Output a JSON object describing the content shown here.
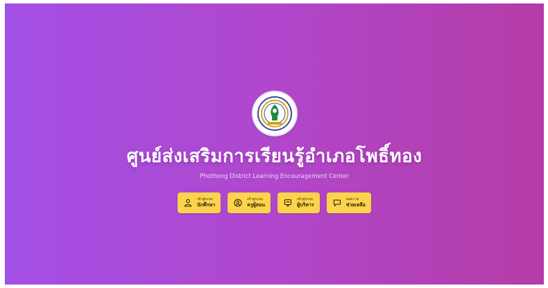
{
  "header": {
    "title": "ศูนย์ส่งเสริมการเรียนรู้อำเภอโพธิ์ทอง",
    "subtitle": "Phothong District Learning Encouragement Center"
  },
  "logo": {
    "icon": "organization-seal-icon"
  },
  "buttons": [
    {
      "small": "เข้าสู่ระบบ",
      "label": "นักศึกษา",
      "icon": "person-icon"
    },
    {
      "small": "เข้าสู่ระบบ",
      "label": "ครูผู้สอน",
      "icon": "teacher-icon"
    },
    {
      "small": "เข้าสู่ระบบ",
      "label": "ผู้บริหาร",
      "icon": "admin-icon"
    },
    {
      "small": "ขอความ",
      "label": "ช่วยเหลือ",
      "icon": "help-chat-icon"
    }
  ],
  "colors": {
    "gradient_start": "#a24fe6",
    "gradient_end": "#b43ca6",
    "button": "#fbd34d"
  }
}
